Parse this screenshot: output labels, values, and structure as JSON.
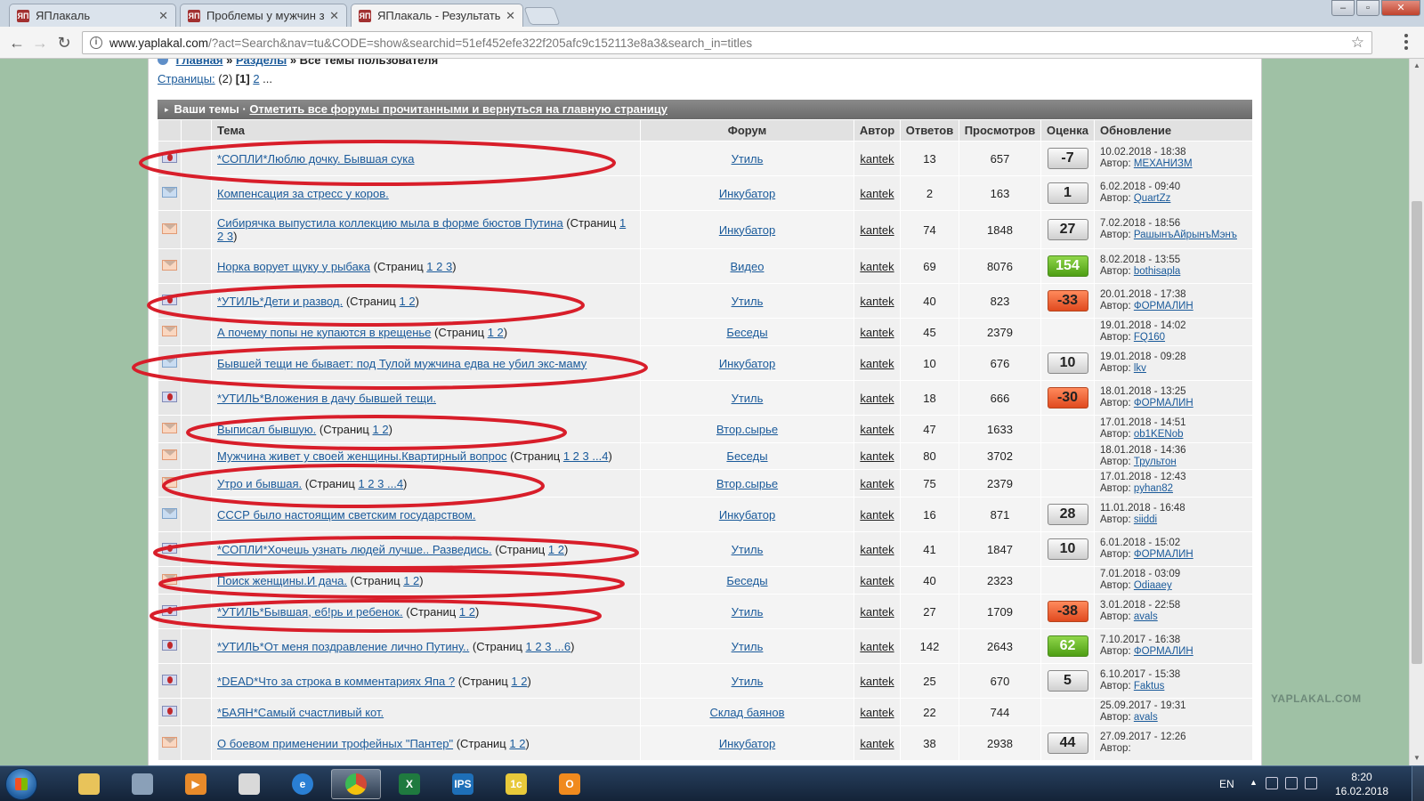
{
  "browser": {
    "tabs": [
      {
        "title": "ЯПлакаль",
        "favicon": "ЯП"
      },
      {
        "title": "Проблемы у мужчин за",
        "favicon": "ЯП"
      },
      {
        "title": "ЯПлакаль - Результаты",
        "favicon": "ЯП"
      }
    ],
    "tab_close": "✕",
    "url_host": "www.yaplakal.com",
    "url_path": "/?act=Search&nav=tu&CODE=show&searchid=51ef452efe322f205afc9c152113e8a3&search_in=titles",
    "window_controls": {
      "minimize": "–",
      "maximize": "▫",
      "close": "✕"
    }
  },
  "page": {
    "crumb_home": "Главная",
    "crumb_sep": "»",
    "crumb_sections": "Разделы",
    "crumb_current": "Все темы пользователя",
    "pages_label": "Страницы:",
    "pages_count": "(2)",
    "current_page": "[1]",
    "next_page": "2",
    "pages_more": "...",
    "block_title": "Ваши темы ·",
    "block_link": "Отметить все форумы прочитанными и вернуться на главную страницу",
    "headers": {
      "topic": "Тема",
      "forum": "Форум",
      "author": "Автор",
      "replies": "Ответов",
      "views": "Просмотров",
      "rating": "Оценка",
      "updated": "Обновление"
    },
    "author_prefix": "Автор:",
    "pages_word": "Страниц",
    "watermark": "YAPLAKAL.COM"
  },
  "rows": [
    {
      "icon": "pinned",
      "title": "*СОПЛИ*Люблю дочку. Бывшая сука",
      "pages": "",
      "forum": "Утиль",
      "author": "kantek",
      "replies": "13",
      "views": "657",
      "rating": "-7",
      "rate_kind": "neutral",
      "date": "10.02.2018 - 18:38",
      "last": "МЕХАНИЗМ",
      "h": 39
    },
    {
      "icon": "env-blue",
      "title": "Компенсация за стресс у коров.",
      "pages": "",
      "forum": "Инкубатор",
      "author": "kantek",
      "replies": "2",
      "views": "163",
      "rating": "1",
      "rate_kind": "neutral",
      "date": "6.02.2018 - 09:40",
      "last": "QuartZz",
      "h": 39
    },
    {
      "icon": "env-orange",
      "title": "Сибирячка выпустила коллекцию мыла в форме бюстов Путина",
      "pages": "1 2 3",
      "forum": "Инкубатор",
      "author": "kantek",
      "replies": "74",
      "views": "1848",
      "rating": "27",
      "rate_kind": "neutral",
      "date": "7.02.2018 - 18:56",
      "last": "РашынъАйрынъМэнъ",
      "h": 43
    },
    {
      "icon": "env-orange",
      "title": "Норка ворует щуку у рыбака",
      "pages": "1 2 3",
      "forum": "Видео",
      "author": "kantek",
      "replies": "69",
      "views": "8076",
      "rating": "154",
      "rate_kind": "pos",
      "date": "8.02.2018 - 13:55",
      "last": "bothisapla",
      "h": 39
    },
    {
      "icon": "pinned",
      "title": "*УТИЛЬ*Дети и развод.",
      "pages": "1 2",
      "forum": "Утиль",
      "author": "kantek",
      "replies": "40",
      "views": "823",
      "rating": "-33",
      "rate_kind": "neg",
      "date": "20.01.2018 - 17:38",
      "last": "ФОРМАЛИН",
      "h": 39
    },
    {
      "icon": "env-orange",
      "title": "А почему попы не купаются в крещенье",
      "pages": "1 2",
      "forum": "Беседы",
      "author": "kantek",
      "replies": "45",
      "views": "2379",
      "rating": "",
      "rate_kind": "none",
      "date": "19.01.2018 - 14:02",
      "last": "FQ160",
      "h": 31
    },
    {
      "icon": "env-blue",
      "title": "Бывшей тещи не бывает: под Тулой мужчина едва не убил экс-маму",
      "pages": "",
      "forum": "Инкубатор",
      "author": "kantek",
      "replies": "10",
      "views": "676",
      "rating": "10",
      "rate_kind": "neutral",
      "date": "19.01.2018 - 09:28",
      "last": "lkv",
      "h": 39
    },
    {
      "icon": "pinned",
      "title": "*УТИЛЬ*Вложения в дачу бывшей тещи.",
      "pages": "",
      "forum": "Утиль",
      "author": "kantek",
      "replies": "18",
      "views": "666",
      "rating": "-30",
      "rate_kind": "neg",
      "date": "18.01.2018 - 13:25",
      "last": "ФОРМАЛИН",
      "h": 39
    },
    {
      "icon": "env-orange",
      "title": "Выписал бывшую.",
      "pages": "1 2",
      "forum": "Втор.сырье",
      "author": "kantek",
      "replies": "47",
      "views": "1633",
      "rating": "",
      "rate_kind": "none",
      "date": "17.01.2018 - 14:51",
      "last": "ob1KENob",
      "h": 31
    },
    {
      "icon": "env-orange",
      "title": "Мужчина живет у своей женщины.Квартирный вопрос",
      "pages": "1 2 3 ...4",
      "forum": "Беседы",
      "author": "kantek",
      "replies": "80",
      "views": "3702",
      "rating": "",
      "rate_kind": "none",
      "date": "18.01.2018 - 14:36",
      "last": "Трультон",
      "h": 30
    },
    {
      "icon": "env-orange",
      "title": "Утро и бывшая.",
      "pages": "1 2 3 ...4",
      "forum": "Втор.сырье",
      "author": "kantek",
      "replies": "75",
      "views": "2379",
      "rating": "",
      "rate_kind": "none",
      "date": "17.01.2018 - 12:43",
      "last": "pyhan82",
      "h": 31
    },
    {
      "icon": "env-blue",
      "title": "СССР было настоящим светским государством.",
      "pages": "",
      "forum": "Инкубатор",
      "author": "kantek",
      "replies": "16",
      "views": "871",
      "rating": "28",
      "rate_kind": "neutral",
      "date": "11.01.2018 - 16:48",
      "last": "siiddi",
      "h": 39
    },
    {
      "icon": "pinned",
      "title": "*СОПЛИ*Хочешь узнать людей лучше.. Разведись.",
      "pages": "1 2",
      "forum": "Утиль",
      "author": "kantek",
      "replies": "41",
      "views": "1847",
      "rating": "10",
      "rate_kind": "neutral",
      "date": "6.01.2018 - 15:02",
      "last": "ФОРМАЛИН",
      "h": 39
    },
    {
      "icon": "env-orange",
      "title": "Поиск женщины.И дача.",
      "pages": "1 2",
      "forum": "Беседы",
      "author": "kantek",
      "replies": "40",
      "views": "2323",
      "rating": "",
      "rate_kind": "none",
      "date": "7.01.2018 - 03:09",
      "last": "Odiaaey",
      "h": 31
    },
    {
      "icon": "pinned",
      "title": "*УТИЛЬ*Бывшая, еб!рь и ребенок.",
      "pages": "1 2",
      "forum": "Утиль",
      "author": "kantek",
      "replies": "27",
      "views": "1709",
      "rating": "-38",
      "rate_kind": "neg",
      "date": "3.01.2018 - 22:58",
      "last": "avals",
      "h": 39
    },
    {
      "icon": "pinned",
      "title": "*УТИЛЬ*От меня поздравление лично Путину..",
      "pages": "1 2 3 ...6",
      "forum": "Утиль",
      "author": "kantek",
      "replies": "142",
      "views": "2643",
      "rating": "62",
      "rate_kind": "pos",
      "date": "7.10.2017 - 16:38",
      "last": "ФОРМАЛИН",
      "h": 39
    },
    {
      "icon": "pinned",
      "title": "*DEAD*Что за строка в комментариях Япа ?",
      "pages": "1 2",
      "forum": "Утиль",
      "author": "kantek",
      "replies": "25",
      "views": "670",
      "rating": "5",
      "rate_kind": "neutral",
      "date": "6.10.2017 - 15:38",
      "last": "Faktus",
      "h": 39
    },
    {
      "icon": "pinned",
      "title": "*БАЯН*Самый счастливый кот.",
      "pages": "",
      "forum": "Склад баянов",
      "author": "kantek",
      "replies": "22",
      "views": "744",
      "rating": "",
      "rate_kind": "none",
      "date": "25.09.2017 - 19:31",
      "last": "avals",
      "h": 31
    },
    {
      "icon": "env-orange",
      "title": "О боевом применении трофейных \"Пантер\"",
      "pages": "1 2",
      "forum": "Инкубатор",
      "author": "kantek",
      "replies": "38",
      "views": "2938",
      "rating": "44",
      "rate_kind": "neutral",
      "date": "27.09.2017 - 12:26",
      "last": "",
      "h": 39
    }
  ],
  "taskbar": {
    "apps": [
      "explorer",
      "scanner",
      "media-player",
      "paint",
      "internet-explorer",
      "chrome",
      "excel",
      "ips",
      "1c",
      "outlook"
    ],
    "lang": "EN",
    "time": "8:20",
    "date": "16.02.2018"
  },
  "colors": {
    "oval": "#d81e2a",
    "link": "#1a5a9a",
    "rate_neg": "#e04a1f",
    "rate_pos": "#4e9e14",
    "desktop": "#9fc1a5"
  }
}
